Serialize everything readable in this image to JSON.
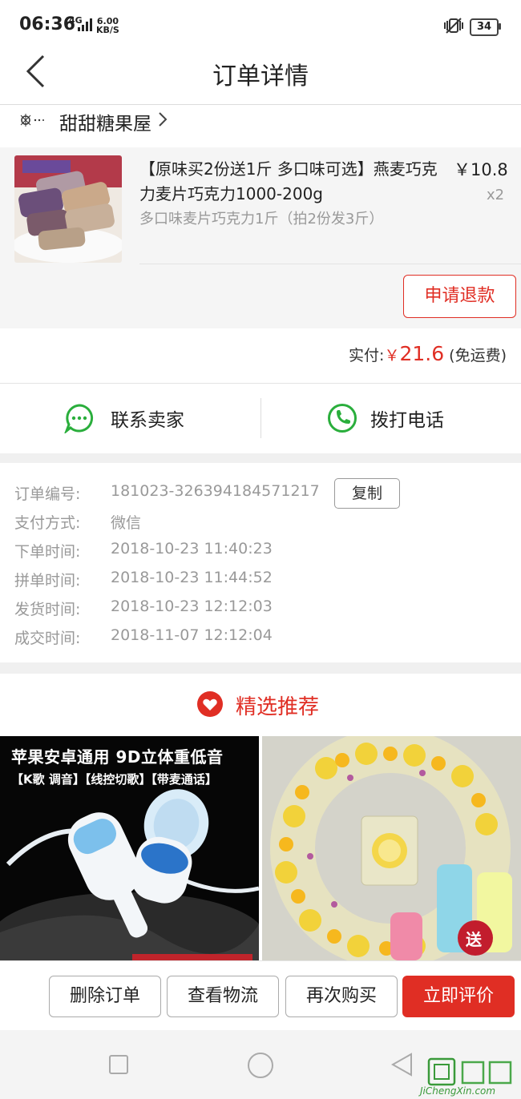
{
  "status_bar": {
    "time": "06:36",
    "network": "4G",
    "speed_value": "6.00",
    "speed_unit": "KB/S",
    "battery": "34"
  },
  "header": {
    "title": "订单详情",
    "back_icon": "chevron-left-icon"
  },
  "shop": {
    "name": "甜甜糖果屋",
    "logo_icon": "shop-logo-icon"
  },
  "product": {
    "title": "【原味买2份送1斤 多口味可选】燕麦巧克力麦片巧克力1000-200g",
    "spec": "多口味麦片巧克力1斤（拍2份发3斤）",
    "price": "￥10.8",
    "quantity": "x2",
    "refund_label": "申请退款"
  },
  "payment": {
    "label": "实付:",
    "currency": "￥",
    "amount": "21.6",
    "shipping": "(免运费)"
  },
  "contact": {
    "seller_label": "联系卖家",
    "call_label": "拨打电话"
  },
  "order_info": {
    "rows": [
      {
        "label": "订单编号:",
        "value": "181023-326394184571217"
      },
      {
        "label": "支付方式:",
        "value": "微信"
      },
      {
        "label": "下单时间:",
        "value": "2018-10-23 11:40:23"
      },
      {
        "label": "拼单时间:",
        "value": "2018-10-23 11:44:52"
      },
      {
        "label": "发货时间:",
        "value": "2018-10-23 12:12:03"
      },
      {
        "label": "成交时间:",
        "value": "2018-11-07 12:12:04"
      }
    ],
    "copy_label": "复制"
  },
  "recommend": {
    "title": "精选推荐",
    "cards": [
      {
        "headline": "苹果安卓通用 9D立体重低音",
        "tags": "【K歌 调音】【线控切歌】【带麦通话】"
      },
      {
        "badge": "送"
      }
    ]
  },
  "actions": {
    "delete": "删除订单",
    "logistics": "查看物流",
    "rebuy": "再次购买",
    "review": "立即评价"
  },
  "watermark": {
    "text": "JiChengXin.com"
  },
  "colors": {
    "accent": "#e02e24",
    "wechat_green": "#2aae3c"
  }
}
